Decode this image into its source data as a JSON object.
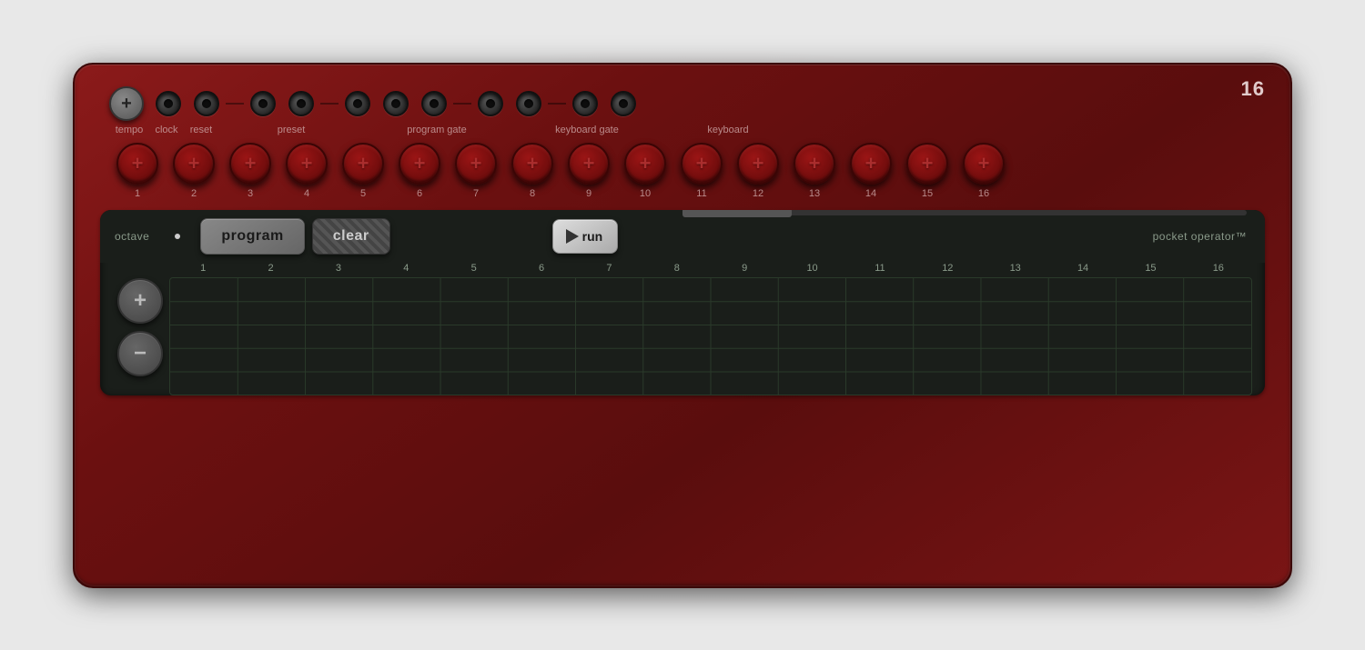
{
  "device": {
    "model": "16",
    "brand": "pocket operator™"
  },
  "jacks": {
    "tempo": {
      "label": "tempo",
      "type": "special"
    },
    "items": [
      {
        "id": "clock",
        "label": "clock",
        "count": 1
      },
      {
        "id": "reset",
        "label": "reset",
        "count": 1
      },
      {
        "id": "preset",
        "label": "preset",
        "count": 2
      },
      {
        "id": "program_gate",
        "label": "program gate",
        "count": 3
      },
      {
        "id": "keyboard_gate",
        "label": "keyboard gate",
        "count": 2
      },
      {
        "id": "keyboard",
        "label": "keyboard",
        "count": 2
      }
    ]
  },
  "knobs": {
    "numbers": [
      "1",
      "2",
      "3",
      "4",
      "5",
      "6",
      "7",
      "8",
      "9",
      "10",
      "11",
      "12",
      "13",
      "14",
      "15",
      "16"
    ]
  },
  "controls": {
    "octave_label": "octave",
    "program_label": "program",
    "clear_label": "clear",
    "run_label": "run",
    "plus_label": "+",
    "minus_label": "−"
  },
  "grid": {
    "numbers": [
      "1",
      "2",
      "3",
      "4",
      "5",
      "6",
      "7",
      "8",
      "9",
      "10",
      "11",
      "12",
      "13",
      "14",
      "15",
      "16"
    ]
  }
}
